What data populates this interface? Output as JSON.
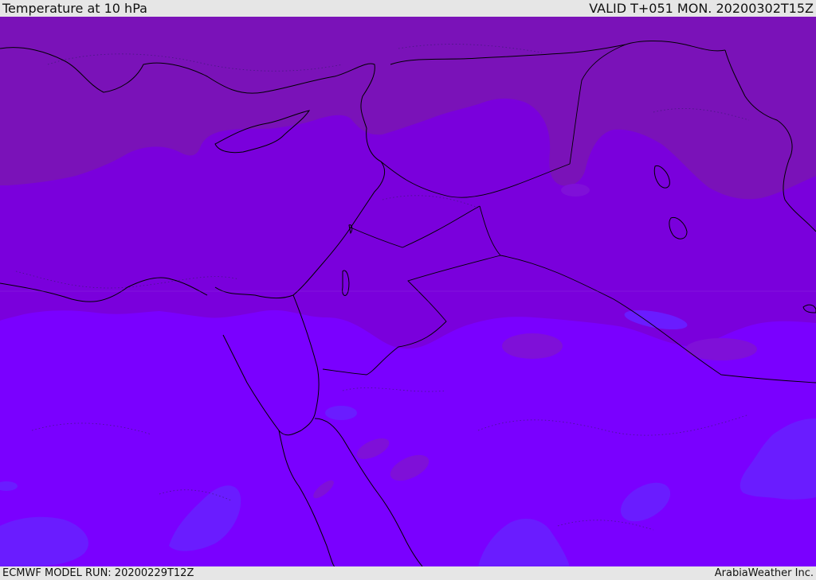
{
  "header": {
    "title": "Temperature at 10 hPa",
    "valid": "VALID T+051 MON. 20200302T15Z"
  },
  "footer": {
    "model_run": "ECMWF MODEL RUN: 20200229T12Z",
    "credit": "ArabiaWeather Inc."
  },
  "colors": {
    "band_north": "#7a12b8",
    "band_middle": "#7a00dc",
    "band_south": "#7a00ff",
    "cool_patch": "#6a1cff",
    "warm_patch": "#7f10d8",
    "coastline": "#000000",
    "background": "#e6e6e6"
  }
}
